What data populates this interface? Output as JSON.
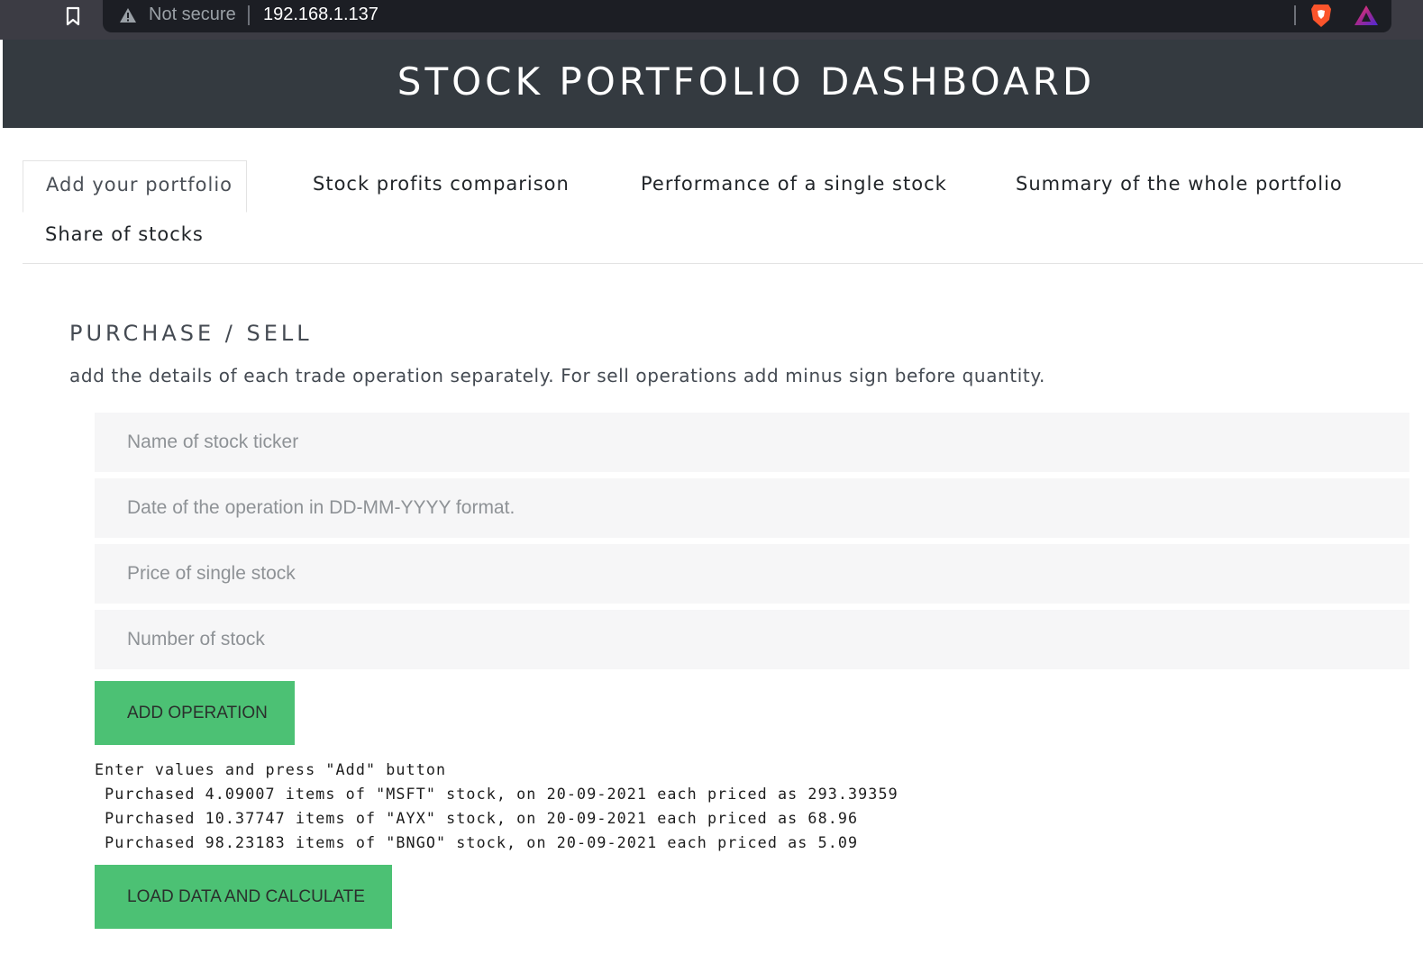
{
  "browser": {
    "security_label": "Not secure",
    "url": "192.168.1.137",
    "icons": [
      "bookmark-icon",
      "warning-icon",
      "brave-shields-icon",
      "brave-rewards-icon"
    ]
  },
  "header": {
    "title": "STOCK PORTFOLIO DASHBOARD"
  },
  "tabs": [
    {
      "label": "Add your portfolio",
      "active": true
    },
    {
      "label": "Stock profits comparison",
      "active": false
    },
    {
      "label": "Performance of a single stock",
      "active": false
    },
    {
      "label": "Summary of the whole portfolio",
      "active": false
    },
    {
      "label": "Share of stocks",
      "active": false
    }
  ],
  "form": {
    "title": "PURCHASE / SELL",
    "description": "add the details of each trade operation separately. For sell operations add minus sign before quantity.",
    "fields": [
      {
        "placeholder": "Name of stock ticker",
        "value": ""
      },
      {
        "placeholder": "Date of the operation in DD-MM-YYYY format.",
        "value": ""
      },
      {
        "placeholder": "Price of single stock",
        "value": ""
      },
      {
        "placeholder": "Number of stock",
        "value": ""
      }
    ],
    "add_button": "ADD OPERATION",
    "load_button": "LOAD DATA AND CALCULATE"
  },
  "log": [
    "Enter values and press \"Add\" button",
    " Purchased 4.09007 items of \"MSFT\" stock, on 20-09-2021 each priced as 293.39359",
    " Purchased 10.37747 items of \"AYX\" stock, on 20-09-2021 each priced as 68.96",
    " Purchased 98.23183 items of \"BNGO\" stock, on 20-09-2021 each priced as 5.09"
  ],
  "colors": {
    "header_bg": "#343a40",
    "button_green": "#4cc174",
    "input_bg": "#f6f6f7"
  }
}
